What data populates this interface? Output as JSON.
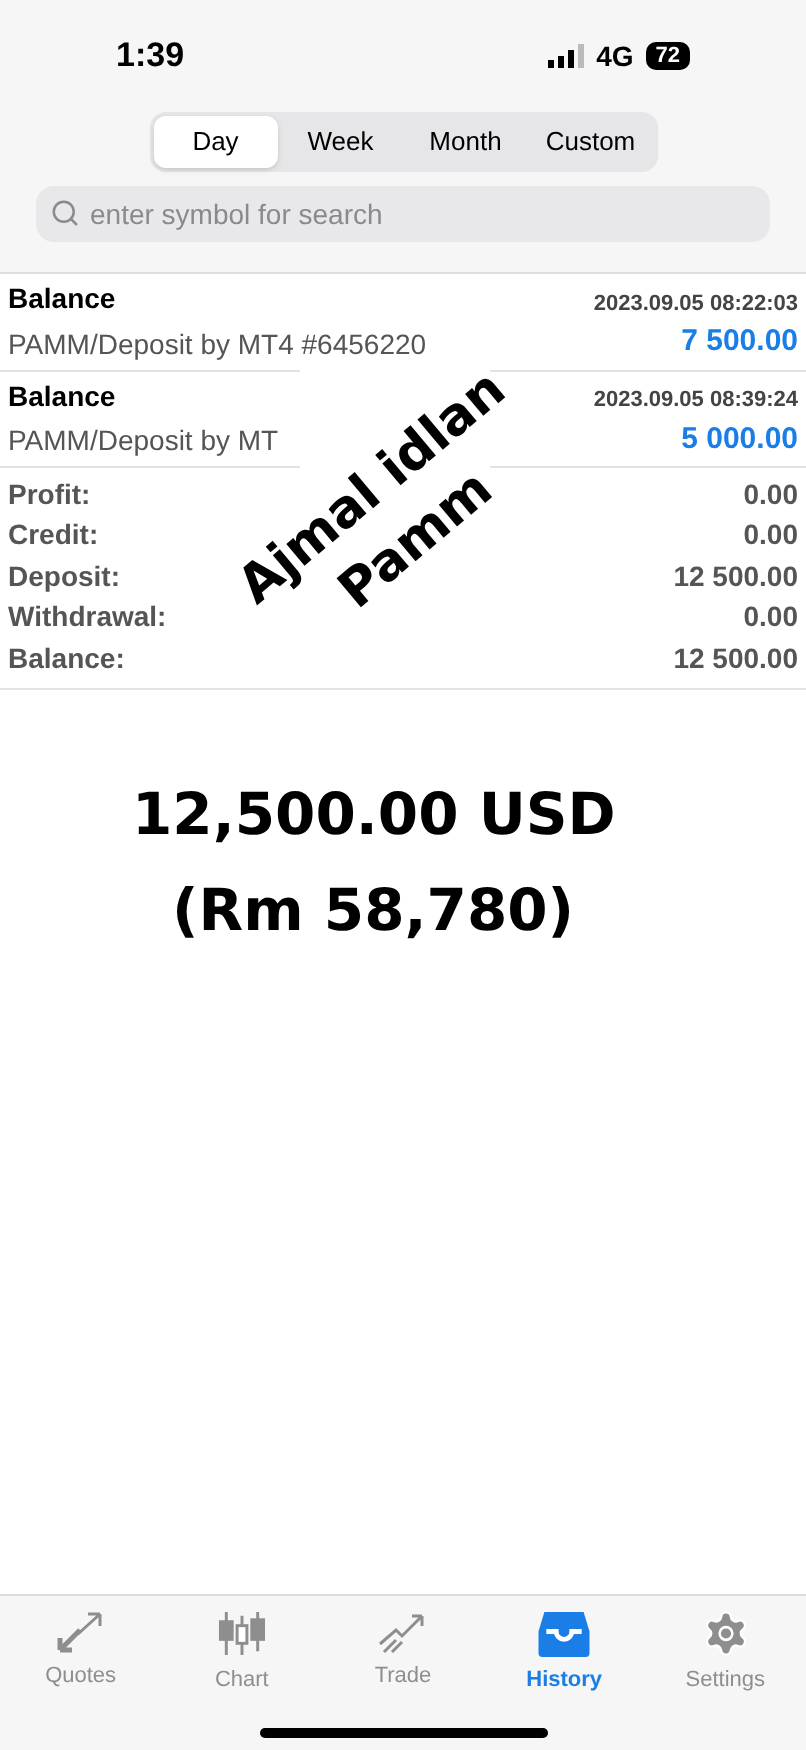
{
  "status_bar": {
    "time": "1:39",
    "network": "4G",
    "battery": "72"
  },
  "periods": [
    {
      "label": "Day",
      "selected": true
    },
    {
      "label": "Week",
      "selected": false
    },
    {
      "label": "Month",
      "selected": false
    },
    {
      "label": "Custom",
      "selected": false
    }
  ],
  "search": {
    "placeholder": "enter symbol for search"
  },
  "deals": [
    {
      "type": "Balance",
      "time": "2023.09.05 08:22:03",
      "comment": "PAMM/Deposit by MT4 #6456220",
      "amount": "7 500.00"
    },
    {
      "type": "Balance",
      "time": "2023.09.05 08:39:24",
      "comment": "PAMM/Deposit by MT",
      "amount": "5 000.00"
    }
  ],
  "summary": [
    {
      "label": "Profit:",
      "value": "0.00"
    },
    {
      "label": "Credit:",
      "value": "0.00"
    },
    {
      "label": "Deposit:",
      "value": "12 500.00"
    },
    {
      "label": "Withdrawal:",
      "value": "0.00"
    },
    {
      "label": "Balance:",
      "value": "12 500.00"
    }
  ],
  "overlay_note": [
    "Ajmal idlan",
    "Pamm"
  ],
  "overlay_total": [
    "12,500.00 USD",
    "(Rm 58,780)"
  ],
  "tab_bar": [
    {
      "kind": "quotes",
      "label": "Quotes",
      "selected": false
    },
    {
      "kind": "chart",
      "label": "Chart",
      "selected": false
    },
    {
      "kind": "trade",
      "label": "Trade",
      "selected": false
    },
    {
      "kind": "history",
      "label": "History",
      "selected": true
    },
    {
      "kind": "settings",
      "label": "Settings",
      "selected": false
    }
  ]
}
